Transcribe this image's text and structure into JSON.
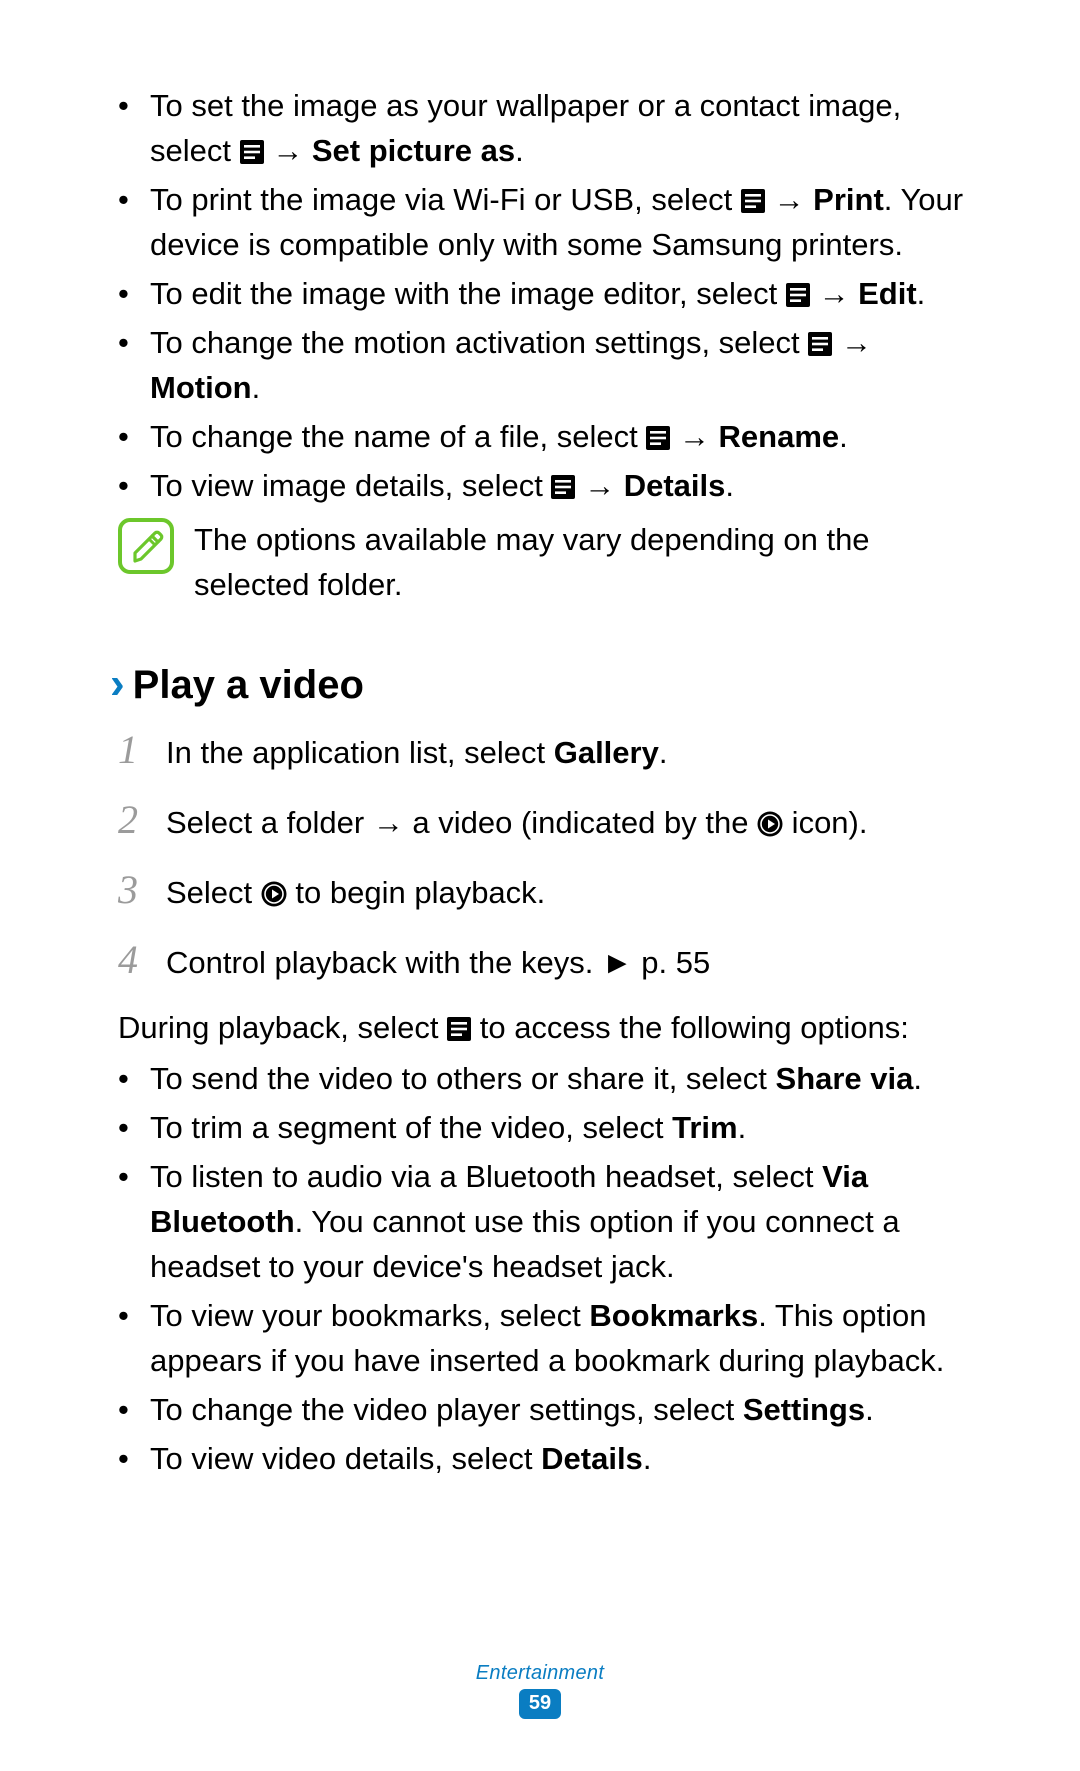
{
  "bullets_top": [
    {
      "pre": "To set the image as your wallpaper or a contact image, select ",
      "icon": "menu",
      "arrow": " → ",
      "bold": "Set picture as",
      "post": "."
    },
    {
      "pre": "To print the image via Wi-Fi or USB, select ",
      "icon": "menu",
      "arrow": " → ",
      "bold": "Print",
      "post": ". Your device is compatible only with some Samsung printers."
    },
    {
      "pre": "To edit the image with the image editor, select ",
      "icon": "menu",
      "arrow": " → ",
      "bold": "Edit",
      "post": "."
    },
    {
      "pre": "To change the motion activation settings, select ",
      "icon": "menu",
      "arrow": " → ",
      "bold": "Motion",
      "post": "."
    },
    {
      "pre": "To change the name of a file, select ",
      "icon": "menu",
      "arrow": " → ",
      "bold": "Rename",
      "post": "."
    },
    {
      "pre": "To view image details, select ",
      "icon": "menu",
      "arrow": " → ",
      "bold": "Details",
      "post": "."
    }
  ],
  "note_text": "The options available may vary depending on the selected folder.",
  "heading": "Play a video",
  "steps": [
    {
      "num": "1",
      "pre": "In the application list, select ",
      "bold": "Gallery",
      "post": "."
    },
    {
      "num": "2",
      "pre": "Select a folder → a video (indicated by the ",
      "icon": "play",
      "post": " icon)."
    },
    {
      "num": "3",
      "pre": "Select ",
      "icon": "play",
      "post": " to begin playback."
    },
    {
      "num": "4",
      "pre": "Control playback with the keys. ",
      "tri": "►",
      "post": " p. 55"
    }
  ],
  "during_pre": "During playback, select ",
  "during_post": " to access the following options:",
  "bullets_bottom": [
    {
      "pre": "To send the video to others or share it, select ",
      "bold": "Share via",
      "post": "."
    },
    {
      "pre": "To trim a segment of the video, select ",
      "bold": "Trim",
      "post": "."
    },
    {
      "pre": "To listen to audio via a Bluetooth headset, select ",
      "bold": "Via Bluetooth",
      "post": ". You cannot use this option if you connect a headset to your device's headset jack."
    },
    {
      "pre": "To view your bookmarks, select ",
      "bold": "Bookmarks",
      "post": ". This option appears if you have inserted a bookmark during playback."
    },
    {
      "pre": "To change the video player settings, select ",
      "bold": "Settings",
      "post": "."
    },
    {
      "pre": "To view video details, select ",
      "bold": "Details",
      "post": "."
    }
  ],
  "footer_section": "Entertainment",
  "page_number": "59"
}
